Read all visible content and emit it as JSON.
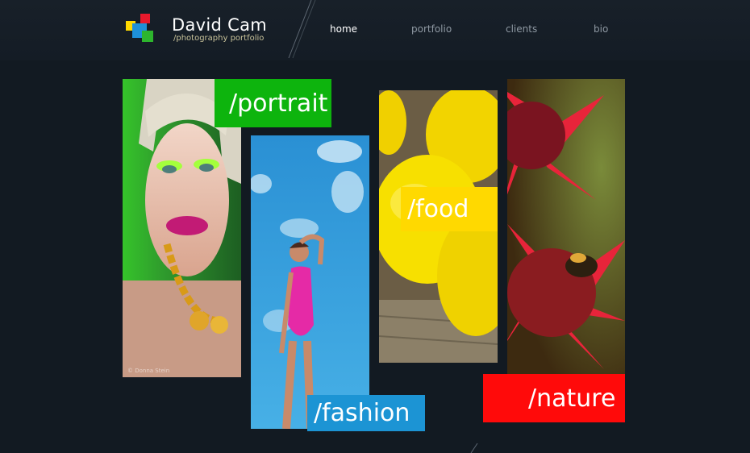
{
  "brand": {
    "name": "David Cam",
    "tagline": "/photography portfolio",
    "colors": {
      "red": "#e8192c",
      "blue": "#1e90d8",
      "green": "#2db52d",
      "yellow": "#ffd900"
    }
  },
  "nav": {
    "items": [
      {
        "label": "home",
        "active": true
      },
      {
        "label": "portfolio",
        "active": false
      },
      {
        "label": "clients",
        "active": false
      },
      {
        "label": "bio",
        "active": false
      }
    ]
  },
  "categories": [
    {
      "label": "/portrait",
      "color": "#0db40d",
      "photo": "portrait-photo"
    },
    {
      "label": "/fashion",
      "color": "#1c94d4",
      "photo": "fashion-photo"
    },
    {
      "label": "/food",
      "color": "#ffd900",
      "photo": "food-photo"
    },
    {
      "label": "/nature",
      "color": "#ff0a0a",
      "photo": "nature-photo"
    }
  ],
  "photo_credit": "© Donna Stein"
}
